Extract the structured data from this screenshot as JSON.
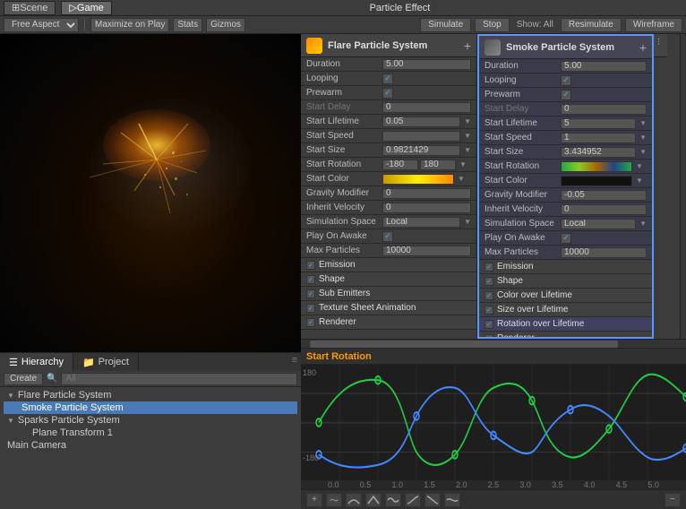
{
  "tabs": [
    {
      "id": "scene",
      "label": "Scene",
      "active": false
    },
    {
      "id": "game",
      "label": "Game",
      "active": true
    }
  ],
  "pe_title": "Particle Effect",
  "pe_toolbar": {
    "simulate": "Simulate",
    "stop": "Stop",
    "show_all": "Show: All",
    "resimulate": "Resimulate",
    "wireframe": "Wireframe"
  },
  "toolbar": {
    "free_aspect": "Free Aspect",
    "maximize_on_play": "Maximize on Play",
    "stats": "Stats",
    "gizmos": "Gizmos"
  },
  "flare_system": {
    "name": "Flare Particle System",
    "props": {
      "duration_label": "Duration",
      "duration_value": "5.00",
      "looping_label": "Looping",
      "prewarm_label": "Prewarm",
      "start_delay_label": "Start Delay",
      "start_delay_value": "0",
      "start_lifetime_label": "Start Lifetime",
      "start_lifetime_value": "0.05",
      "start_speed_label": "Start Speed",
      "start_speed_value": "",
      "start_size_label": "Start Size",
      "start_size_value": "0.9821429",
      "start_rotation_label": "Start Rotation",
      "start_rotation_min": "-180",
      "start_rotation_max": "180",
      "start_color_label": "Start Color",
      "gravity_label": "Gravity Modifier",
      "gravity_value": "0",
      "inherit_velocity_label": "Inherit Velocity",
      "inherit_velocity_value": "0",
      "simulation_space_label": "Simulation Space",
      "simulation_space_value": "Local",
      "play_on_awake_label": "Play On Awake",
      "max_particles_label": "Max Particles",
      "max_particles_value": "10000",
      "emission_label": "Emission",
      "shape_label": "Shape",
      "sub_emitters_label": "Sub Emitters",
      "texture_sheet_label": "Texture Sheet Animation",
      "renderer_label": "Renderer"
    }
  },
  "smoke_system": {
    "name": "Smoke Particle System",
    "props": {
      "duration_label": "Duration",
      "duration_value": "5.00",
      "looping_label": "Looping",
      "prewarm_label": "Prewarm",
      "start_delay_label": "Start Delay",
      "start_delay_value": "0",
      "start_lifetime_label": "Start Lifetime",
      "start_lifetime_value": "5",
      "start_speed_label": "Start Speed",
      "start_speed_value": "1",
      "start_size_label": "Start Size",
      "start_size_value": "3.434952",
      "start_rotation_label": "Start Rotation",
      "gravity_label": "Gravity Modifier",
      "gravity_value": "-0.05",
      "inherit_velocity_label": "Inherit Velocity",
      "inherit_velocity_value": "0",
      "simulation_space_label": "Simulation Space",
      "simulation_space_value": "Local",
      "play_on_awake_label": "Play On Awake",
      "max_particles_label": "Max Particles",
      "max_particles_value": "10000",
      "emission_label": "Emission",
      "shape_label": "Shape",
      "color_over_lifetime_label": "Color over Lifetime",
      "size_over_lifetime_label": "Size over Lifetime",
      "rotation_over_lifetime_label": "Rotation over Lifetime",
      "renderer_label": "Renderer"
    }
  },
  "third_system": {
    "name": "Sparks Particle System"
  },
  "hierarchy": {
    "create_label": "Create",
    "search_placeholder": "All",
    "items": [
      {
        "label": "Flare Particle System",
        "indent": 0,
        "expanded": true,
        "selected": false
      },
      {
        "label": "Smoke Particle System",
        "indent": 1,
        "expanded": false,
        "selected": true
      },
      {
        "label": "Sparks Particle System",
        "indent": 0,
        "expanded": true,
        "selected": false
      },
      {
        "label": "Plane Transform 1",
        "indent": 2,
        "expanded": false,
        "selected": false
      },
      {
        "label": "Main Camera",
        "indent": 0,
        "expanded": false,
        "selected": false
      }
    ]
  },
  "graph": {
    "title": "Start Rotation",
    "y_label": "180",
    "x_labels": [
      "0.0",
      "0.5",
      "1.0",
      "1.5",
      "2.0",
      "2.5",
      "3.0",
      "3.5",
      "4.0",
      "4.5",
      "5.0"
    ]
  }
}
